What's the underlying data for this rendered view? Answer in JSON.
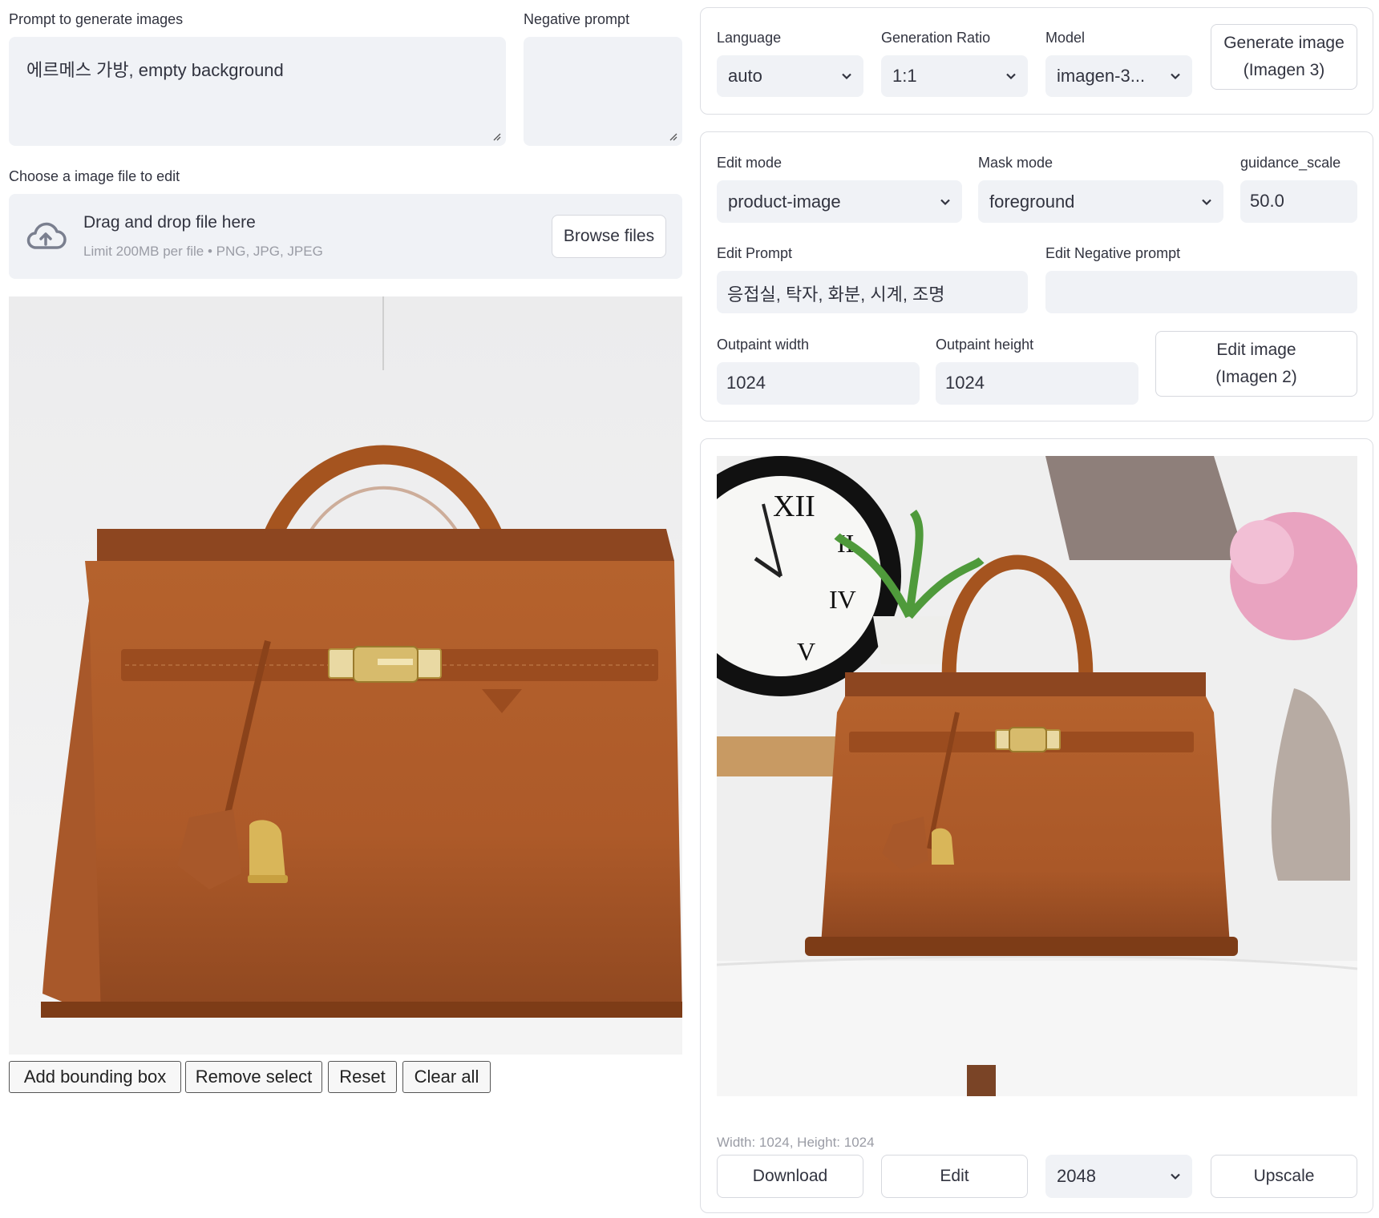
{
  "left": {
    "prompt_label": "Prompt to generate images",
    "prompt_value": "에르메스 가방, empty background",
    "negative_label": "Negative prompt",
    "negative_value": "",
    "upload_label": "Choose a image file to edit",
    "dropzone_title": "Drag and drop file here",
    "dropzone_limit": "Limit 200MB per file • PNG, JPG, JPEG",
    "browse_label": "Browse files",
    "canvas_buttons": [
      "Add bounding box",
      "Remove select",
      "Reset",
      "Clear all"
    ]
  },
  "gen_card": {
    "language_label": "Language",
    "language_value": "auto",
    "ratio_label": "Generation Ratio",
    "ratio_value": "1:1",
    "model_label": "Model",
    "model_value": "imagen-3...",
    "generate_button_line1": "Generate image",
    "generate_button_line2": "(Imagen 3)"
  },
  "edit_card": {
    "edit_mode_label": "Edit mode",
    "edit_mode_value": "product-image",
    "mask_mode_label": "Mask mode",
    "mask_mode_value": "foreground",
    "guidance_label": "guidance_scale",
    "guidance_value": "50.0",
    "edit_prompt_label": "Edit Prompt",
    "edit_prompt_value": "응접실, 탁자, 화분, 시계, 조명",
    "edit_negative_label": "Edit Negative prompt",
    "edit_negative_value": "",
    "outpaint_width_label": "Outpaint width",
    "outpaint_width_value": "1024",
    "outpaint_height_label": "Outpaint height",
    "outpaint_height_value": "1024",
    "edit_button_line1": "Edit image",
    "edit_button_line2": "(Imagen 2)"
  },
  "result_card": {
    "caption": "Width: 1024, Height: 1024",
    "download_label": "Download",
    "edit_label": "Edit",
    "upscale_value": "2048",
    "upscale_label": "Upscale"
  },
  "colors": {
    "field_bg": "#f0f2f6",
    "leather": "#b0602e",
    "text": "#31333f"
  }
}
